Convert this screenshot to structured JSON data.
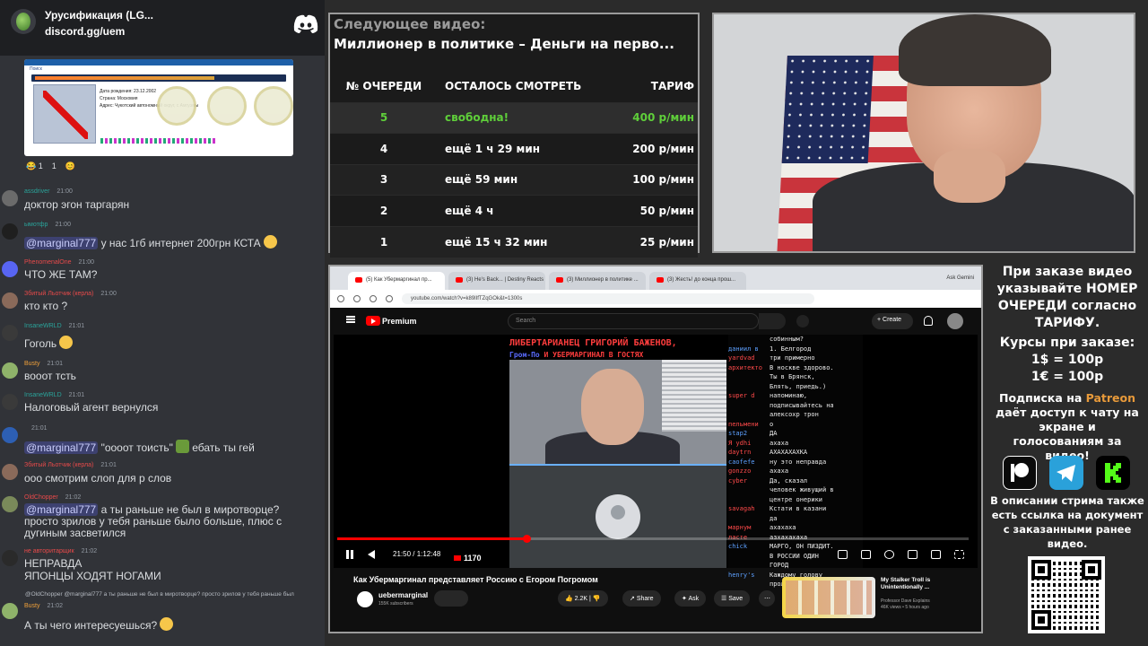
{
  "discord": {
    "server_name": "Урусификация (LG...",
    "server_link": "discord.gg/uem",
    "embed": {
      "search_label": "Поиск",
      "info_lines": [
        "Дата рождения: 23.12.2002",
        "Страна: Московия",
        "Адрес: Чукотский автономный округ, с Амгуэмы"
      ]
    },
    "reactions": [
      "😂 1",
      "1",
      "😊"
    ],
    "messages": [
      {
        "author": "assdriver",
        "time": "21:00",
        "text": "доктор эгон таргарян"
      },
      {
        "author": "ымотфр",
        "time": "21:00",
        "mention": "@marginal777",
        "text": "у нас 1гб интернет 200грн КСТА"
      },
      {
        "author": "PhenomenalOne",
        "time": "21:00",
        "text": "ЧТО ЖЕ ТАМ?"
      },
      {
        "author": "Збитый Льотчик (керла)",
        "time": "21:00",
        "text": "кто кто ?"
      },
      {
        "author": "InsaneWRLD",
        "time": "21:01",
        "text": "Гоголь"
      },
      {
        "author": "Busty",
        "time": "21:01",
        "text": "вооот тсть"
      },
      {
        "author": "InsaneWRLD",
        "time": "21:01",
        "text": "Налоговый агент вернулся"
      },
      {
        "author": "",
        "time": "21:01",
        "mention": "@marginal777",
        "text": "\"ооoот тоисть\"",
        "text2": "ебать ты гей"
      },
      {
        "author": "Збитый Льотчик (керла)",
        "time": "21:01",
        "text": "ооо смотрим слоп для р слов"
      },
      {
        "author": "OldChopper",
        "time": "21:02",
        "mention": "@marginal777",
        "text": "а ты раньше не был в миротворце?",
        "text2": "просто зрилов у тебя раньше было больше, плюс с",
        "text3": "дугиным засветился"
      },
      {
        "author": "не авторитарщик",
        "time": "21:02",
        "text": "НЕПРАВДА",
        "text2": "ЯПОНЦЫ ХОДЯТ НОГАМИ"
      },
      {
        "reply": "@OldChopper @marginal777 а ты раньше не был в миротворце? просто зрилов у тебя раньше был",
        "author": "Busty",
        "time": "21:02",
        "text": "А ты чего интересуешься?"
      }
    ]
  },
  "queue": {
    "next_label": "Следующее видео:",
    "next_title": "Миллионер в политике – Деньги на перво...",
    "headers": [
      "№ ОЧЕРЕДИ",
      "ОСТАЛОСЬ СМОТРЕТЬ",
      "ТАРИФ"
    ],
    "rows": [
      {
        "num": "5",
        "left": "свободна!",
        "price": "400 р/мин"
      },
      {
        "num": "4",
        "left": "ещё 1 ч 29 мин",
        "price": "200 р/мин"
      },
      {
        "num": "3",
        "left": "ещё 59 мин",
        "price": "100 р/мин"
      },
      {
        "num": "2",
        "left": "ещё 4 ч",
        "price": "50 р/мин"
      },
      {
        "num": "1",
        "left": "ещё 15 ч 32 мин",
        "price": "25 р/мин"
      }
    ]
  },
  "browser": {
    "tabs": [
      "(5) Как Убермаргинал пр...",
      "(3) He's Back... | Destiny Reacts",
      "(3) Миллионер в политике ...",
      "(3) Жесть! до конца прош..."
    ],
    "ask_gemini": "Ask Gemini",
    "url": "youtube.com/watch?v=k89lIfTZqGOk&t=1300s"
  },
  "youtube": {
    "brand": "Premium",
    "search_placeholder": "Search",
    "create": "+ Create",
    "banner_line1": "ЛИБЕРТАРИАНЕЦ ГРИГОРИЙ БАЖЕНОВ,",
    "banner_line2_a": "Гром-По",
    "banner_line2_b": " И УБЕРМАРГИНАЛ В ГОСТЯХ",
    "chat_lines": [
      {
        "u": "",
        "t": "собинным?"
      },
      {
        "u": "даниил в",
        "t": "1. Белгород"
      },
      {
        "u": "yardvad",
        "t": "три примерно"
      },
      {
        "u": "архитекто",
        "t": "В носкве здорово."
      },
      {
        "u": "",
        "t": "Ты в Брянск,"
      },
      {
        "u": "",
        "t": "Блять, приедь.)"
      },
      {
        "u": "super d",
        "t": "напоминаю,"
      },
      {
        "u": "",
        "t": "подписывайтесь на"
      },
      {
        "u": "",
        "t": "алексоxp трон"
      },
      {
        "u": "пельмени",
        "t": "о"
      },
      {
        "u": "stap2",
        "t": "ДА"
      },
      {
        "u": "Я ydhi",
        "t": "ахаха"
      },
      {
        "u": "daytrn",
        "t": "АХАХАХАХКА"
      },
      {
        "u": "caofefe",
        "t": "ну это неправда"
      },
      {
        "u": "gonzzo",
        "t": "ахаха"
      },
      {
        "u": "cyber",
        "t": "Да, сказал"
      },
      {
        "u": "",
        "t": "человек живущий в"
      },
      {
        "u": "",
        "t": "центре онерики"
      },
      {
        "u": "savagah",
        "t": "Кстати в казани"
      },
      {
        "u": "",
        "t": "да"
      },
      {
        "u": "марнум",
        "t": "ахахаха"
      },
      {
        "u": "ласте",
        "t": "азхахахаха"
      },
      {
        "u": "chick",
        "t": "МАРГО, ОН ПИЗДИТ."
      },
      {
        "u": "",
        "t": "В РОССИИ ОДИН"
      },
      {
        "u": "",
        "t": "ГОРОД"
      },
      {
        "u": "henry's",
        "t": "Каждому голову"
      },
      {
        "u": "",
        "t": "проломили японцы?"
      }
    ],
    "time": "21:50 / 1:12:48",
    "viewers": "1170",
    "progress": 0.3,
    "video_title": "Как Убермаргинал представляет Россию с Егором Погромом",
    "channel": "uebermarginal",
    "subs": "155K subscribers",
    "likes": "2.2K",
    "share": "Share",
    "ask": "Ask",
    "save": "Save",
    "rec_title": "My Stalker Troll is Unintentionally ...",
    "rec_channel": "Professor Dave Explains",
    "rec_meta": "46K views • 5 hours ago"
  },
  "side": {
    "order_info": "При заказе видео указывайте НОМЕР ОЧЕРЕДИ согласно ТАРИФУ.",
    "rates_title": "Курсы при заказе:",
    "rate1": "1$ = 100р",
    "rate2": "1€ = 100р",
    "sub_a": "Подписка на ",
    "patreon": "Patreon",
    "sub_b": " даёт доступ к чату на экране и голосованиям за видео!",
    "desc_info": "В описании стрима также есть ссылка на документ с заказанными ранее видео.",
    "colors": {
      "patreon": "#e89a3a",
      "telegram": "#2aa1da",
      "kick": "#53fc18"
    }
  }
}
